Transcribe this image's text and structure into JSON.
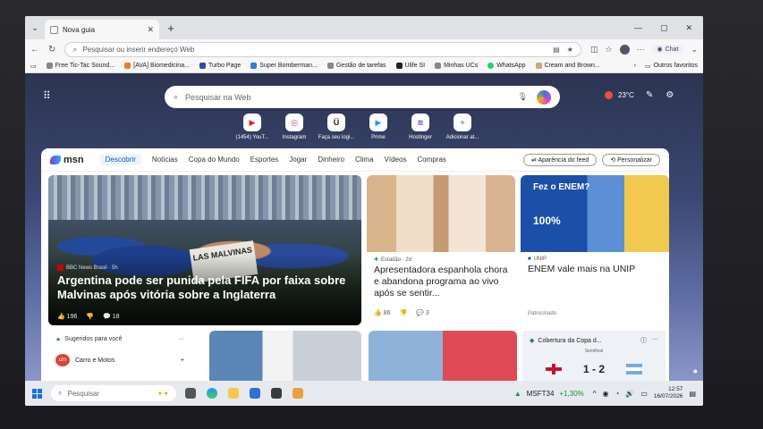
{
  "browser": {
    "tab_title": "Nova guia",
    "address_placeholder": "Pesquisar ou inserir endereço Web",
    "chat_label": "Chat"
  },
  "bookmarks": [
    {
      "label": "Free Tic-Tac Sound..."
    },
    {
      "label": "[AVA] Biomedicina..."
    },
    {
      "label": "Turbo Page"
    },
    {
      "label": "Super Bomberman..."
    },
    {
      "label": "Gestão de tarefas"
    },
    {
      "label": "Ulife SI"
    },
    {
      "label": "Minhas UCs"
    },
    {
      "label": "WhatsApp"
    },
    {
      "label": "Cream and Brown..."
    }
  ],
  "bookmarks_more": "Outros favoritos",
  "search": {
    "placeholder": "Pesquisar na Web"
  },
  "weather": {
    "temp": "23°C"
  },
  "quicklinks": [
    {
      "label": "(1454) YouT...",
      "icon": "youtube-icon",
      "glyph": "▶",
      "color": "#e62117"
    },
    {
      "label": "Instagram",
      "icon": "instagram-icon",
      "glyph": "◎",
      "color": "#d62976"
    },
    {
      "label": "Faça seu logi...",
      "icon": "ulife-icon",
      "glyph": "Ü",
      "color": "#222222"
    },
    {
      "label": "Prime",
      "icon": "prime-icon",
      "glyph": "▶",
      "color": "#1a98ff"
    },
    {
      "label": "Hostinger",
      "icon": "hostinger-icon",
      "glyph": "≋",
      "color": "#673de6"
    },
    {
      "label": "Adicionar at...",
      "icon": "add-icon",
      "glyph": "+",
      "color": "#888888"
    }
  ],
  "feed": {
    "brand": "msn",
    "nav": [
      "Descobrir",
      "Notícias",
      "Copa do Mundo",
      "Esportes",
      "Jogar",
      "Dinheiro",
      "Clima",
      "Vídeos",
      "Compras"
    ],
    "feed_appearance": "Aparência do feed",
    "personalize": "Personalizar"
  },
  "hero": {
    "source": "BBC News Brasil · 5h",
    "title": "Argentina pode ser punida pela FIFA por faixa sobre Malvinas após vitória sobre a Inglaterra",
    "likes": "196",
    "comments": "18",
    "sign_text": "LAS MALVINAS"
  },
  "card1": {
    "source": "Estadão · 2d",
    "title": "Apresentadora espanhola chora e abandona programa ao vivo após se sentir...",
    "likes": "86",
    "comments": "3"
  },
  "card2": {
    "source": "UNIP",
    "title": "ENEM vale mais na UNIP",
    "sponsored": "Patrocinado",
    "ad_text": "Fez o ENEM?",
    "ad_percent": "100%"
  },
  "suggested": {
    "header": "Sugeridos para você",
    "item": "Carro e Motos"
  },
  "cup": {
    "header": "Cobertura da Copa d...",
    "stage": "Semifinal",
    "score": "1 - 2"
  },
  "taskbar": {
    "search": "Pesquisar",
    "stock_name": "MSFT34",
    "stock_change": "+1,30%",
    "time": "12:57",
    "date": "16/07/2026"
  }
}
